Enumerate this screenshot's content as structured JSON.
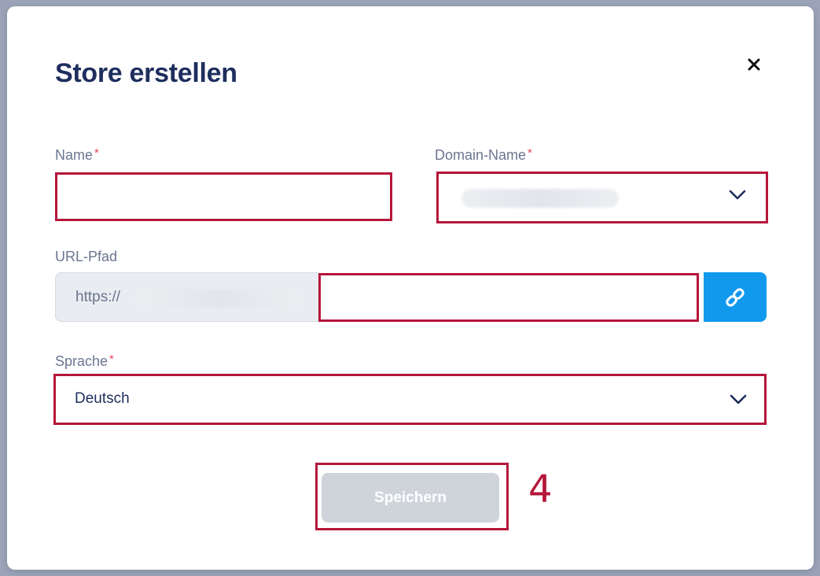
{
  "dialog": {
    "title": "Store erstellen",
    "close_icon": "close-icon"
  },
  "form": {
    "name": {
      "label": "Name",
      "required_mark": "*",
      "value": ""
    },
    "domain": {
      "label": "Domain-Name",
      "required_mark": "*",
      "value": "",
      "icon": "chevron-down-icon"
    },
    "url_path": {
      "label": "URL-Pfad",
      "prefix": "https://",
      "value": "",
      "link_icon": "link-icon"
    },
    "language": {
      "label": "Sprache",
      "required_mark": "*",
      "value": "Deutsch",
      "icon": "chevron-down-icon"
    }
  },
  "actions": {
    "save_label": "Speichern",
    "save_enabled": false
  },
  "annotation": {
    "step_number": "4"
  },
  "colors": {
    "title": "#1e2e5e",
    "accent": "#1199ee",
    "required": "#e2455a",
    "highlight": "#b5163a",
    "disabled_button": "#cfd4db"
  }
}
